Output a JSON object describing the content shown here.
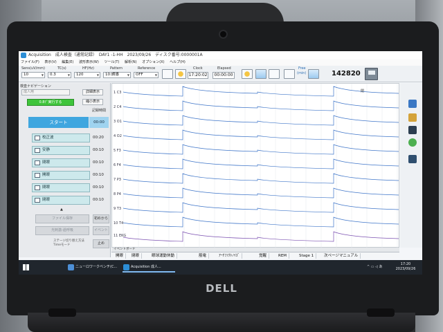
{
  "window": {
    "title": "Acquisition　成人検査（通常記録）　DAY1 -1-HH　2023/09/26　ディスク番号:0000001A",
    "menu": [
      "ファイル(F)",
      "表示(V)",
      "編集(E)",
      "波形表示(W)",
      "ツール(T)",
      "解析(N)",
      "オプション(X)",
      "ヘルプ(H)"
    ]
  },
  "toolbar": {
    "sens_label": "Sens(uV/mm)",
    "sens_value": "10",
    "tc_label": "TC(s)",
    "tc_value": "0.3",
    "hf_label": "HF(Hz)",
    "hf_value": "120",
    "pattern_label": "Pattern",
    "pattern_value": "10:誘導",
    "reference_label": "Reference",
    "reference_value": "OFF",
    "clock_label": "Clock",
    "clock_value": "17:20:02",
    "elapsed_label": "Elapsed",
    "elapsed_value": "00:00:00",
    "free_label": "Free",
    "free_unit": "(min)",
    "counter": "142820"
  },
  "left_panel": {
    "header": "検査ナビゲーション",
    "mode_select": "成人用",
    "detail_button": "詳細表示",
    "auto_button": "0.8ﾃﾞ実行する",
    "shrink_button": "縮小表示",
    "count_label": "記録時間",
    "start_button": "スタート",
    "start_time": "00:00",
    "steps": [
      {
        "label": "校正波",
        "time": "00:20"
      },
      {
        "label": "安静",
        "time": "00:10"
      },
      {
        "label": "閉眼",
        "time": "00:10"
      },
      {
        "label": "開眼",
        "time": "00:10"
      },
      {
        "label": "閉眼",
        "time": "00:10"
      },
      {
        "label": "閉眼",
        "time": "00:10"
      }
    ],
    "file_save_button": "ファイル保存",
    "restart_button": "初めから",
    "light_button": "光刺激-過呼吸",
    "event_button": "イベント",
    "note": "ステージ切り替え方法\nTimeモード",
    "end_button": "止め"
  },
  "waveform": {
    "channel_labels": [
      "1 C3",
      "2 C4",
      "3 O1",
      "4 O2",
      "5 F3",
      "6 F4",
      "7 P3",
      "8 P4",
      "9 T3",
      "10 T4",
      "11 EKG"
    ],
    "annotation": "閉"
  },
  "stage_bar": {
    "header": "イベントボード",
    "buttons": [
      "開眼",
      "閉眼",
      "眼球運動休動",
      "筋電",
      "ｱｰﾁﾌｧｸﾄﾉｲｽﾞ",
      "覚醒",
      "REM",
      "Stage 1",
      "次ページマニュアル"
    ]
  },
  "taskbar": {
    "apps": [
      "ニューロワークベンチ(C...",
      "Acquisition 成人..."
    ],
    "time": "17:20",
    "date": "2023/09/26"
  },
  "laptop": {
    "brand": "DELL"
  }
}
